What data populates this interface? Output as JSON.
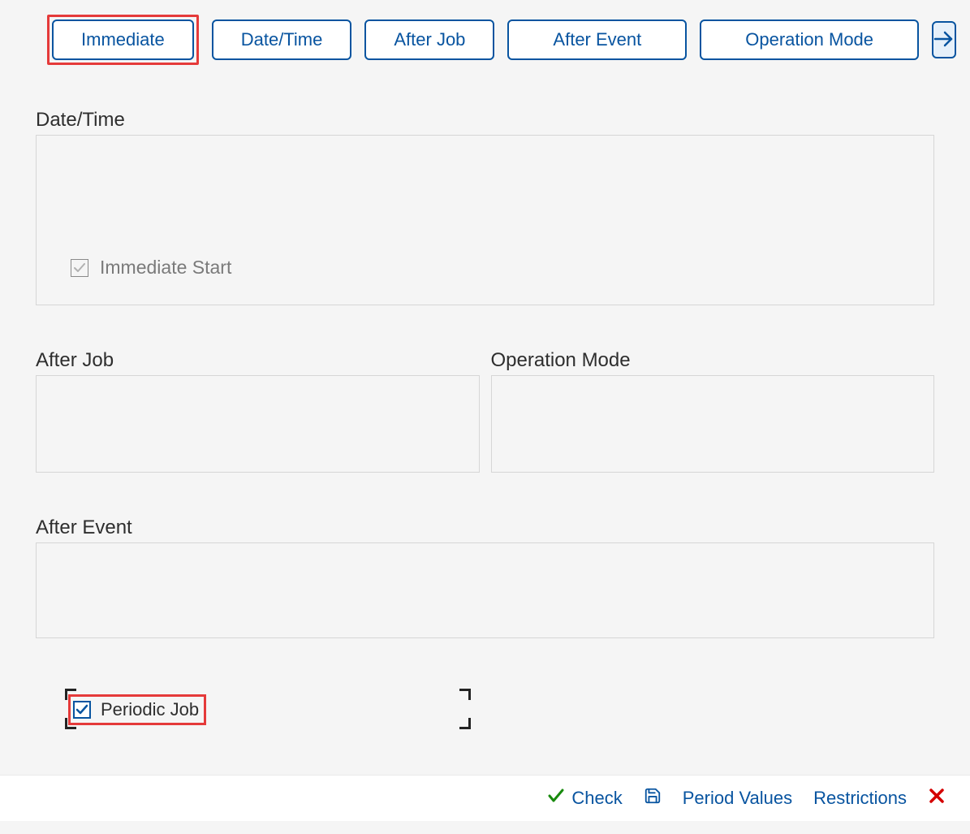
{
  "tabs": {
    "immediate": "Immediate",
    "datetime": "Date/Time",
    "afterjob": "After Job",
    "afterevent": "After Event",
    "operationmode": "Operation Mode"
  },
  "sections": {
    "datetime_title": "Date/Time",
    "immediate_start_label": "Immediate Start",
    "afterjob_title": "After Job",
    "operationmode_title": "Operation Mode",
    "afterevent_title": "After Event",
    "periodic_job_label": "Periodic Job"
  },
  "footer": {
    "check": "Check",
    "period_values": "Period Values",
    "restrictions": "Restrictions"
  }
}
